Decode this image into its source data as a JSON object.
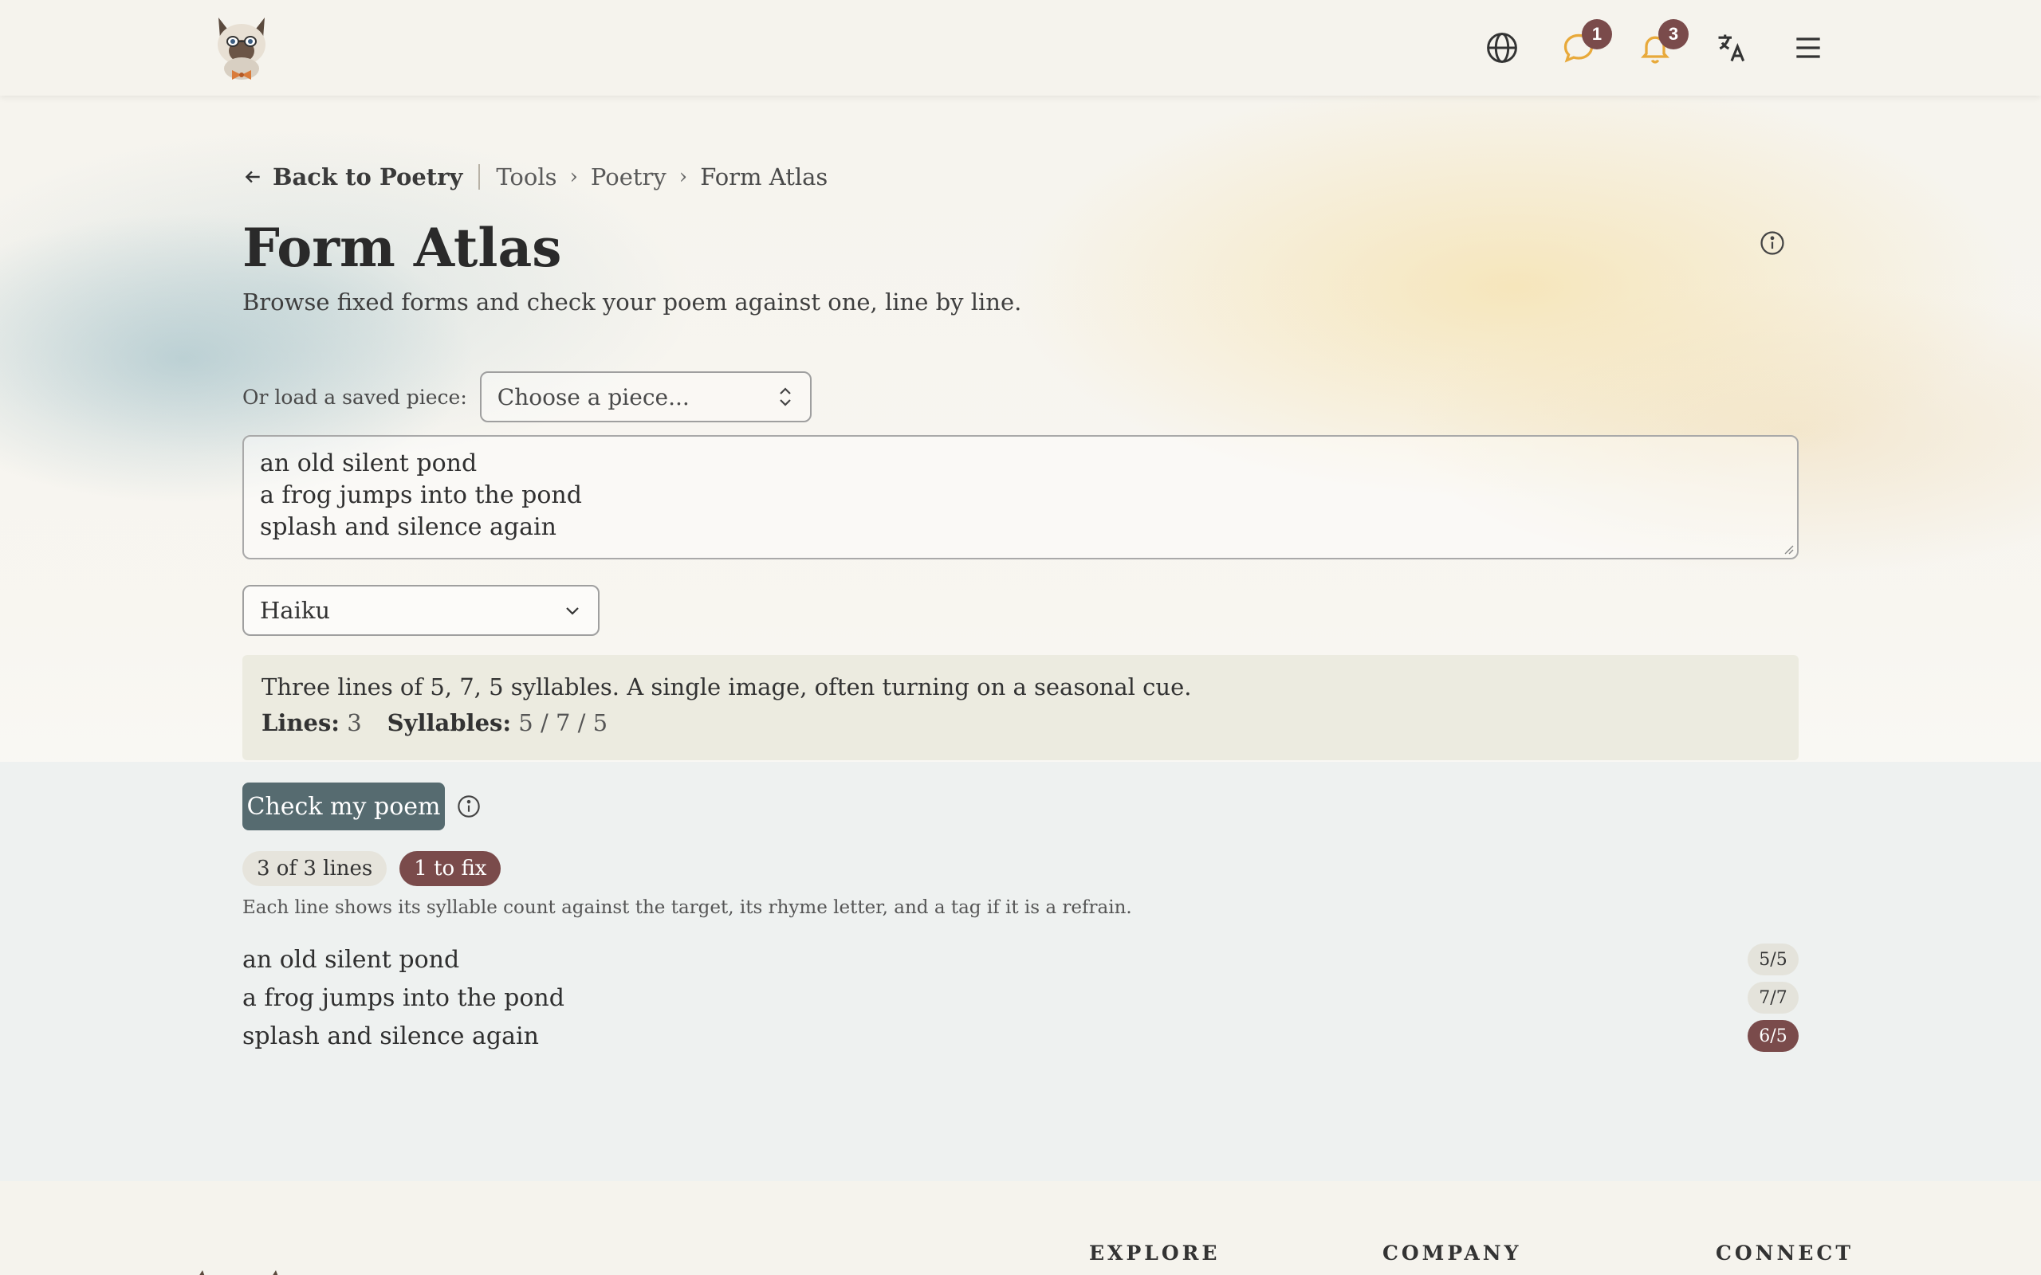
{
  "nav": {
    "messages_badge": "1",
    "notifications_badge": "3"
  },
  "breadcrumb": {
    "back_label": "Back to Poetry",
    "items": [
      "Tools",
      "Poetry"
    ],
    "current": "Form Atlas"
  },
  "header": {
    "title": "Form Atlas",
    "subtitle": "Browse fixed forms and check your poem against one, line by line."
  },
  "load": {
    "label": "Or load a saved piece:",
    "placeholder": "Choose a piece..."
  },
  "poem": {
    "lines": [
      "an old silent pond",
      "a frog jumps into the pond",
      "splash and silence again"
    ]
  },
  "form_select": {
    "selected": "Haiku"
  },
  "form_info": {
    "description": "Three lines of 5, 7, 5 syllables. A single image, often turning on a seasonal cue.",
    "lines_label": "Lines:",
    "lines_value": "3",
    "syllables_label": "Syllables:",
    "syllables_value": "5 / 7 / 5"
  },
  "check": {
    "button_label": "Check my poem"
  },
  "summary": {
    "lines_pill": "3 of 3 lines",
    "fix_pill": "1 to fix"
  },
  "results": {
    "note": "Each line shows its syllable count against the target, its rhyme letter, and a tag if it is a refrain.",
    "rows": [
      {
        "text": "an old silent pond",
        "count": "5/5"
      },
      {
        "text": "a frog jumps into the pond",
        "count": "7/7"
      },
      {
        "text": "splash and silence again",
        "count": "6/5"
      }
    ]
  },
  "footer": {
    "explore": "EXPLORE",
    "company": "COMPANY",
    "connect": "CONNECT"
  },
  "colors": {
    "accent_button": "#566b70",
    "warning": "#7a4b4b",
    "notification": "#e8a93a"
  },
  "icons": {
    "globe": "globe-icon",
    "messages": "chat-bubble-icon",
    "notifications": "bell-icon",
    "translate": "translate-icon",
    "menu": "hamburger-menu-icon",
    "info": "info-icon"
  }
}
